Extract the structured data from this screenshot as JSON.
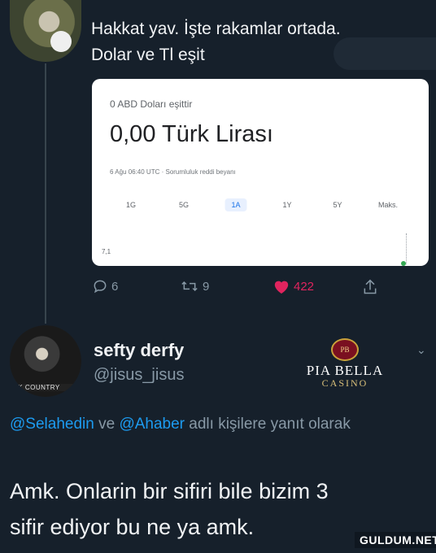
{
  "tweet1": {
    "text_line1": "Hakkat yav. İşte rakamlar ortada.",
    "text_line2": "Dolar ve Tl eşit",
    "card": {
      "subtitle": "0 ABD Doları eşittir",
      "amount": "0,00 Türk Lirası",
      "date_disclaimer": "6 Ağu 06:40 UTC · Sorumluluk reddi beyanı",
      "tabs": [
        "1G",
        "5G",
        "1A",
        "1Y",
        "5Y",
        "Maks."
      ],
      "active_tab": "1A",
      "y_value": "7,1"
    },
    "actions": {
      "replies": "6",
      "retweets": "9",
      "likes": "422"
    },
    "colors": {
      "like": "#e0245e",
      "mention": "#1d9bf0"
    }
  },
  "tweet2": {
    "display_name": "sefty derfy",
    "handle": "@jisus_jisus",
    "avatar_text": "RK COUNTRY",
    "reply_prefix_mention1": "@Selahedin",
    "reply_and": " ve ",
    "reply_prefix_mention2": "@Ahaber",
    "reply_suffix": " adlı kişilere yanıt olarak",
    "body_line1": "Amk. Onlarin bir sifiri bile bizim 3",
    "body_line2": "sifir ediyor bu ne ya amk."
  },
  "ad_logo": {
    "crest": "PB",
    "brand": "PIA BELLA",
    "sub": "CASINO"
  },
  "watermark": "GULDUM.NET"
}
